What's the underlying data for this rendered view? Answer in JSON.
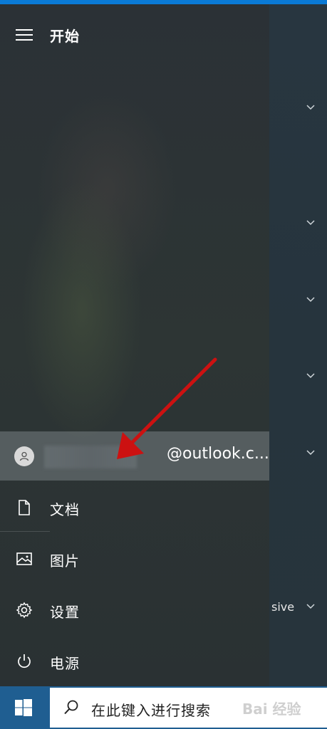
{
  "start_menu": {
    "title": "开始",
    "account": {
      "email_fragment": "@outlook.c..."
    },
    "items": [
      {
        "label": "文档",
        "icon": "document-icon"
      },
      {
        "label": "图片",
        "icon": "pictures-icon"
      },
      {
        "label": "设置",
        "icon": "gear-icon"
      },
      {
        "label": "电源",
        "icon": "power-icon"
      }
    ]
  },
  "right_panel": {
    "partial_text": "sive"
  },
  "taskbar": {
    "search_placeholder": "在此键入进行搜索",
    "watermark": "Bai 经验"
  },
  "colors": {
    "taskbar": "#1f5e91",
    "accent_top": "#0a7ad6",
    "annotation_arrow": "#cc1111"
  }
}
